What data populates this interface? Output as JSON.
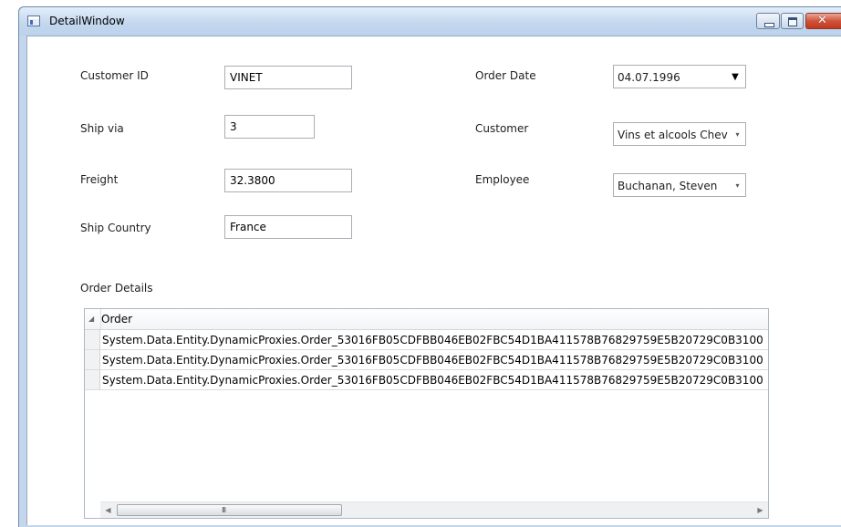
{
  "window": {
    "title": "DetailWindow",
    "caption_icons": [
      "minimize-icon",
      "maximize-icon",
      "close-icon"
    ],
    "close_glyph": "✕"
  },
  "form": {
    "customer_id": {
      "label": "Customer ID",
      "value": "VINET"
    },
    "ship_via": {
      "label": "Ship via",
      "value": "3"
    },
    "freight": {
      "label": "Freight",
      "value": "32.3800"
    },
    "ship_country": {
      "label": "Ship Country",
      "value": "France"
    },
    "order_date": {
      "label": "Order Date",
      "value": "04.07.1996"
    },
    "customer": {
      "label": "Customer",
      "value": "Vins et alcools Chev"
    },
    "employee": {
      "label": "Employee",
      "value": "Buchanan, Steven"
    }
  },
  "order_details": {
    "label": "Order Details",
    "columns": [
      "Order"
    ],
    "rows": [
      "System.Data.Entity.DynamicProxies.Order_53016FB05CDFBB046EB02FBC54D1BA411578B76829759E5B20729C0B3100",
      "System.Data.Entity.DynamicProxies.Order_53016FB05CDFBB046EB02FBC54D1BA411578B76829759E5B20729C0B3100",
      "System.Data.Entity.DynamicProxies.Order_53016FB05CDFBB046EB02FBC54D1BA411578B76829759E5B20729C0B3100"
    ],
    "scroll_grip": "III"
  },
  "colors": {
    "titlebar": "#c2d6ee",
    "close_button": "#c3371f",
    "input_border": "#abadb3"
  }
}
